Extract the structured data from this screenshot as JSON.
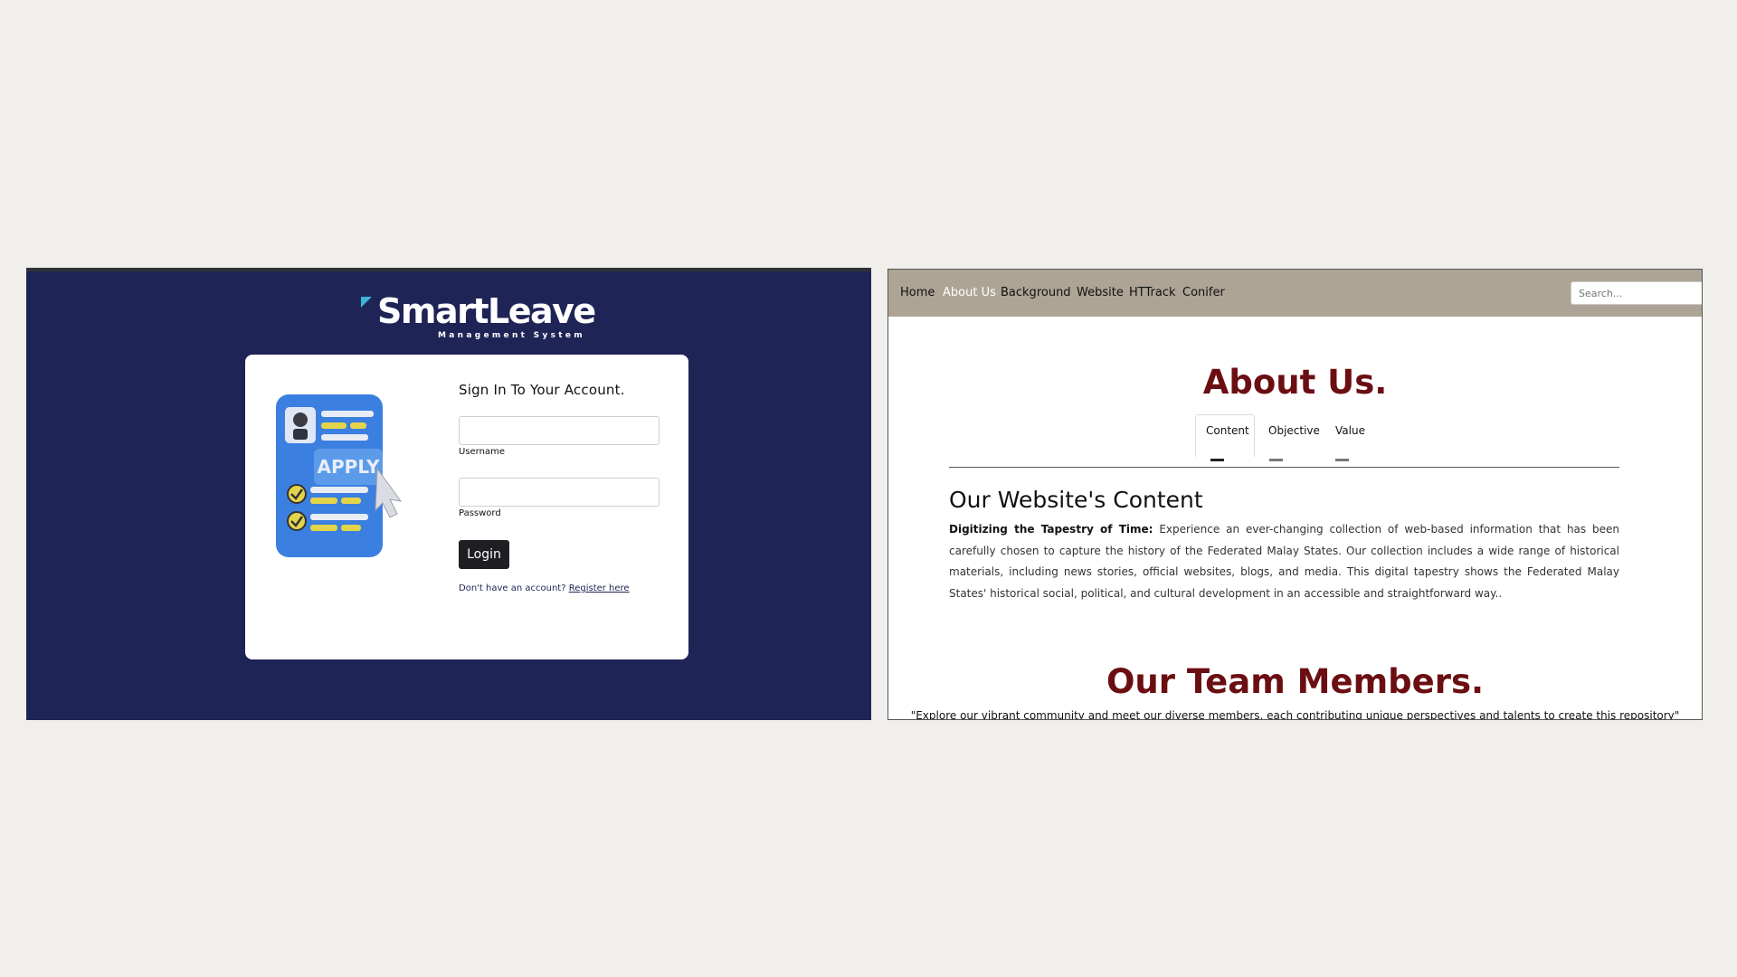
{
  "login_app": {
    "logo": {
      "title": "SmartLeave",
      "subtitle": "Management System"
    },
    "card": {
      "title": "Sign In To Your Account.",
      "illustration": {
        "button_text": "APPLY"
      },
      "username_label": "Username",
      "password_label": "Password",
      "login_button": "Login",
      "register_prompt": "Don't have an account?",
      "register_link": "Register here"
    },
    "colors": {
      "background": "#1f2456",
      "button": "#1f1f23",
      "accent": "#3cb5d4"
    }
  },
  "about_site": {
    "nav": {
      "items": [
        "Home",
        "About Us",
        "Background",
        "Website",
        "HTTrack",
        "Conifer"
      ],
      "active": "About Us",
      "search_placeholder": "Search..."
    },
    "page_title": "About Us.",
    "tabs": [
      "Content",
      "Objective",
      "Value"
    ],
    "active_tab": "Content",
    "section_heading": "Our Website's Content",
    "paragraph_lead": "Digitizing the Tapestry of Time:",
    "paragraph_body": "Experience an ever-changing collection of web-based information that has been carefully chosen to capture the history of the Federated Malay States. Our collection includes a wide range of historical materials, including news stories, official websites, blogs, and media. This digital tapestry shows the Federated Malay States' historical social, political, and cultural development in an accessible and straightforward way..",
    "team_title": "Our Team Members.",
    "team_quote": "\"Explore our vibrant community and meet our diverse members, each contributing unique perspectives and talents to create this repository\"",
    "colors": {
      "nav_bg": "#ada495",
      "title": "#6b0e12"
    }
  }
}
